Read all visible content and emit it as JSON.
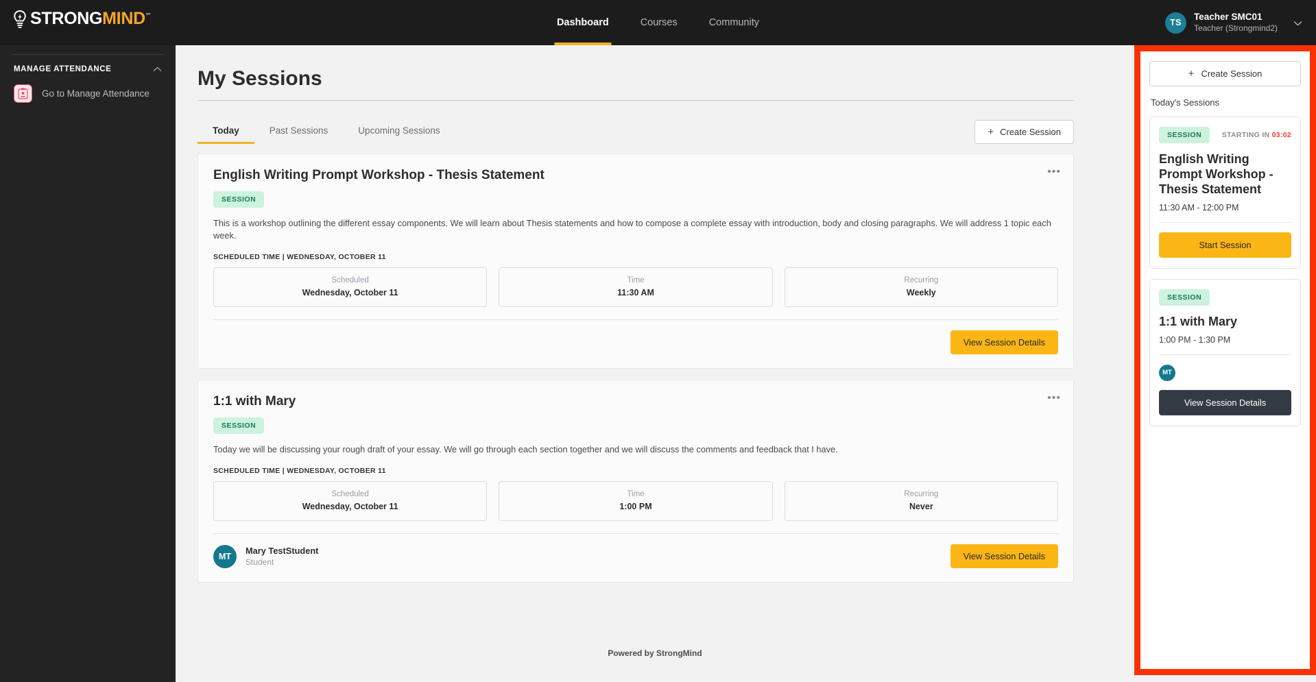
{
  "topnav": {
    "logo": {
      "part1": "STRONG",
      "part2": "MIND",
      "tm": "℠",
      "icon": "lightbulb-icon"
    },
    "links": [
      {
        "label": "Dashboard",
        "active": true
      },
      {
        "label": "Courses",
        "active": false
      },
      {
        "label": "Community",
        "active": false
      }
    ],
    "user": {
      "initials": "TS",
      "name": "Teacher SMC01",
      "role": "Teacher (Strongmind2)",
      "chevron": "⌄"
    }
  },
  "sidebar": {
    "section_title": "MANAGE ATTENDANCE",
    "collapse_chevron": "⌃",
    "items": [
      {
        "label": "Go to Manage Attendance",
        "icon": "attendance-clipboard-icon"
      }
    ]
  },
  "main": {
    "page_title": "My Sessions",
    "tabs": [
      {
        "label": "Today",
        "active": true
      },
      {
        "label": "Past Sessions",
        "active": false
      },
      {
        "label": "Upcoming Sessions",
        "active": false
      }
    ],
    "create_session_label": "Create Session",
    "plus": "+",
    "kebab": "•••",
    "detail_headers": {
      "scheduled": "Scheduled",
      "time": "Time",
      "recurring": "Recurring"
    },
    "view_details_label": "View Session Details",
    "cards": [
      {
        "title": "English Writing Prompt Workshop - Thesis Statement",
        "badge": "SESSION",
        "description": "This is a workshop outlining the different essay components. We will learn about Thesis statements and how to compose a complete essay with introduction, body and closing paragraphs. We will address 1 topic each week.",
        "scheduled_time_label": "SCHEDULED TIME | WEDNESDAY, OCTOBER 11",
        "scheduled_value": "Wednesday, October 11",
        "time_value": "11:30 AM",
        "recurring_value": "Weekly",
        "button": "View Session Details"
      },
      {
        "title": "1:1 with Mary",
        "badge": "SESSION",
        "description": "Today we will be discussing your rough draft of your essay. We will go through each section together and we will discuss the comments and feedback that I have.",
        "scheduled_time_label": "SCHEDULED TIME | WEDNESDAY, OCTOBER 11",
        "scheduled_value": "Wednesday, October 11",
        "time_value": "1:00 PM",
        "recurring_value": "Never",
        "participant": {
          "initials": "MT",
          "name": "Mary TestStudent",
          "role": "Student"
        },
        "button": "View Session Details"
      }
    ],
    "footer": "Powered by StrongMind"
  },
  "right_panel": {
    "create_session_label": "Create Session",
    "plus": "+",
    "todays_sessions_label": "Today's Sessions",
    "cards": [
      {
        "badge": "SESSION",
        "starting_in_label": "STARTING IN",
        "countdown": "03:02",
        "title": "English Writing Prompt Workshop - Thesis Statement",
        "time_range": "11:30 AM - 12:00 PM",
        "button": "Start Session",
        "button_style": "yellow"
      },
      {
        "badge": "SESSION",
        "title": "1:1 with Mary",
        "time_range": "1:00 PM - 1:30 PM",
        "participant_initials": "MT",
        "button": "View Session Details",
        "button_style": "dark"
      }
    ]
  },
  "colors": {
    "nav_bg": "#1c1c1c",
    "sidebar_bg": "#232323",
    "accent_yellow": "#f0b323",
    "button_yellow": "#fbb615",
    "badge_green_bg": "#cdf2de",
    "badge_green_text": "#18794e",
    "avatar_teal": "#15788f",
    "countdown_red": "#ef3d2a",
    "highlight_border": "#fa3203",
    "dark_button": "#343a44"
  }
}
